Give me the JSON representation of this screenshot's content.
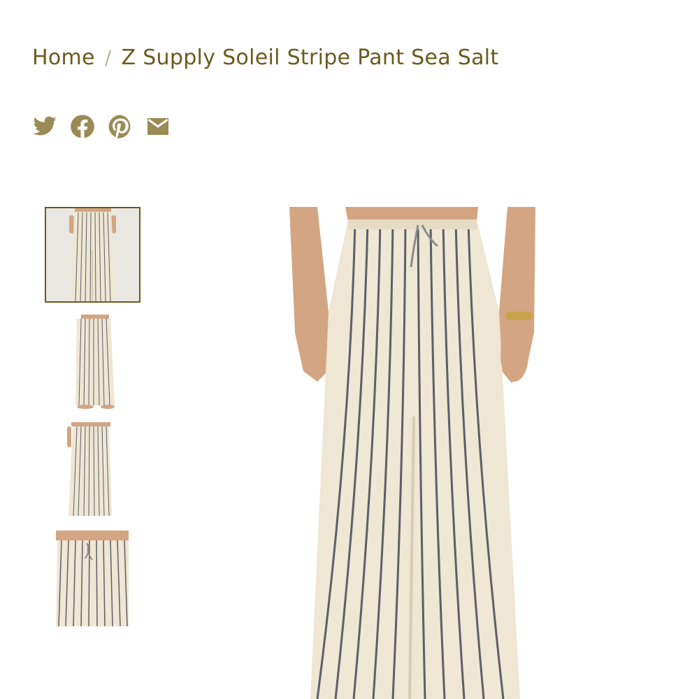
{
  "breadcrumb": {
    "home": "Home",
    "separator": "/",
    "current": "Z Supply Soleil Stripe Pant Sea Salt"
  },
  "share": {
    "icons": [
      "twitter-icon",
      "facebook-icon",
      "pinterest-icon",
      "email-icon"
    ]
  },
  "gallery": {
    "thumbnail_count": 4,
    "active_index": 0
  },
  "colors": {
    "accent": "#6b5a1e",
    "icon": "#9a8a55",
    "fabric": "#efe6d3",
    "stripe": "#5b5f6a",
    "skin": "#d3a582"
  }
}
